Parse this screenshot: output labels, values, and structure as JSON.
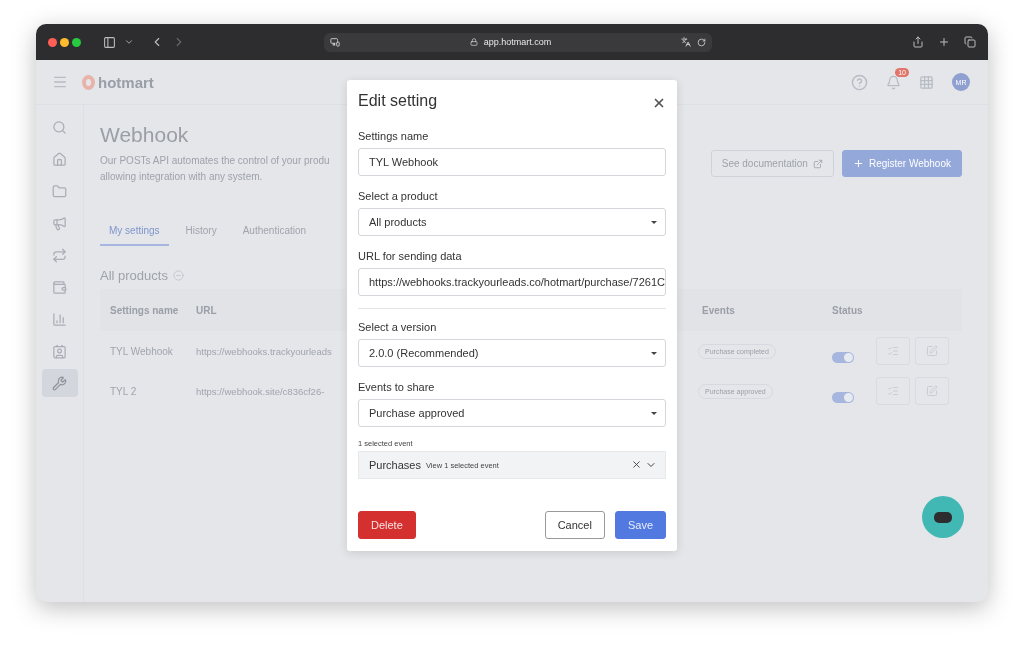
{
  "browser": {
    "url": "app.hotmart.com"
  },
  "header": {
    "logo": "hotmart",
    "notification_count": "10",
    "avatar_initials": "MR"
  },
  "sidebar": {
    "items": [
      {
        "selected": false
      },
      {
        "selected": false
      },
      {
        "selected": false
      },
      {
        "selected": false
      },
      {
        "selected": false
      },
      {
        "selected": false
      },
      {
        "selected": false
      },
      {
        "selected": false
      },
      {
        "selected": true
      }
    ]
  },
  "page": {
    "title": "Webhook",
    "description_lines": [
      "Our POSTs API automates the control of your produ",
      "allowing integration with any system."
    ],
    "buttons": [
      {
        "kind": "outline",
        "label": "See documentation"
      },
      {
        "kind": "primary",
        "label": "Register Webhook"
      }
    ],
    "tabs": [
      {
        "label": "My settings",
        "selected": true
      },
      {
        "label": "History",
        "selected": false
      },
      {
        "label": "Authentication",
        "selected": false
      }
    ],
    "section_title": "All products",
    "table": {
      "columns": [
        "Settings name",
        "URL",
        "Events",
        "Status"
      ],
      "rows": [
        {
          "name": "TYL Webhook",
          "url": "https://webhooks.trackyourleads",
          "event": "Purchase completed",
          "on": true
        },
        {
          "name": "TYL 2",
          "url": "https://webhook.site/c836cf26-",
          "event": "Purchase approved",
          "on": true
        }
      ]
    }
  },
  "modal": {
    "title": "Edit setting",
    "fields_top": [
      {
        "kind": "input",
        "label": "Settings name",
        "value": "TYL Webhook"
      },
      {
        "kind": "select",
        "label": "Select a product",
        "value": "All products"
      },
      {
        "kind": "input",
        "label": "URL for sending data",
        "value": "https://webhooks.trackyourleads.co/hotmart/purchase/7261C"
      }
    ],
    "fields_bottom": [
      {
        "kind": "select",
        "label": "Select a version",
        "value": "2.0.0 (Recommended)"
      },
      {
        "kind": "select",
        "label": "Events to share",
        "value": "Purchase approved"
      }
    ],
    "events_caption": "1 selected event",
    "events_group": {
      "name": "Purchases",
      "detail": "View 1 selected event"
    },
    "buttons": [
      {
        "kind": "danger",
        "label": "Delete"
      },
      {
        "kind": "secondary",
        "label": "Cancel"
      },
      {
        "kind": "primary",
        "label": "Save"
      }
    ]
  }
}
